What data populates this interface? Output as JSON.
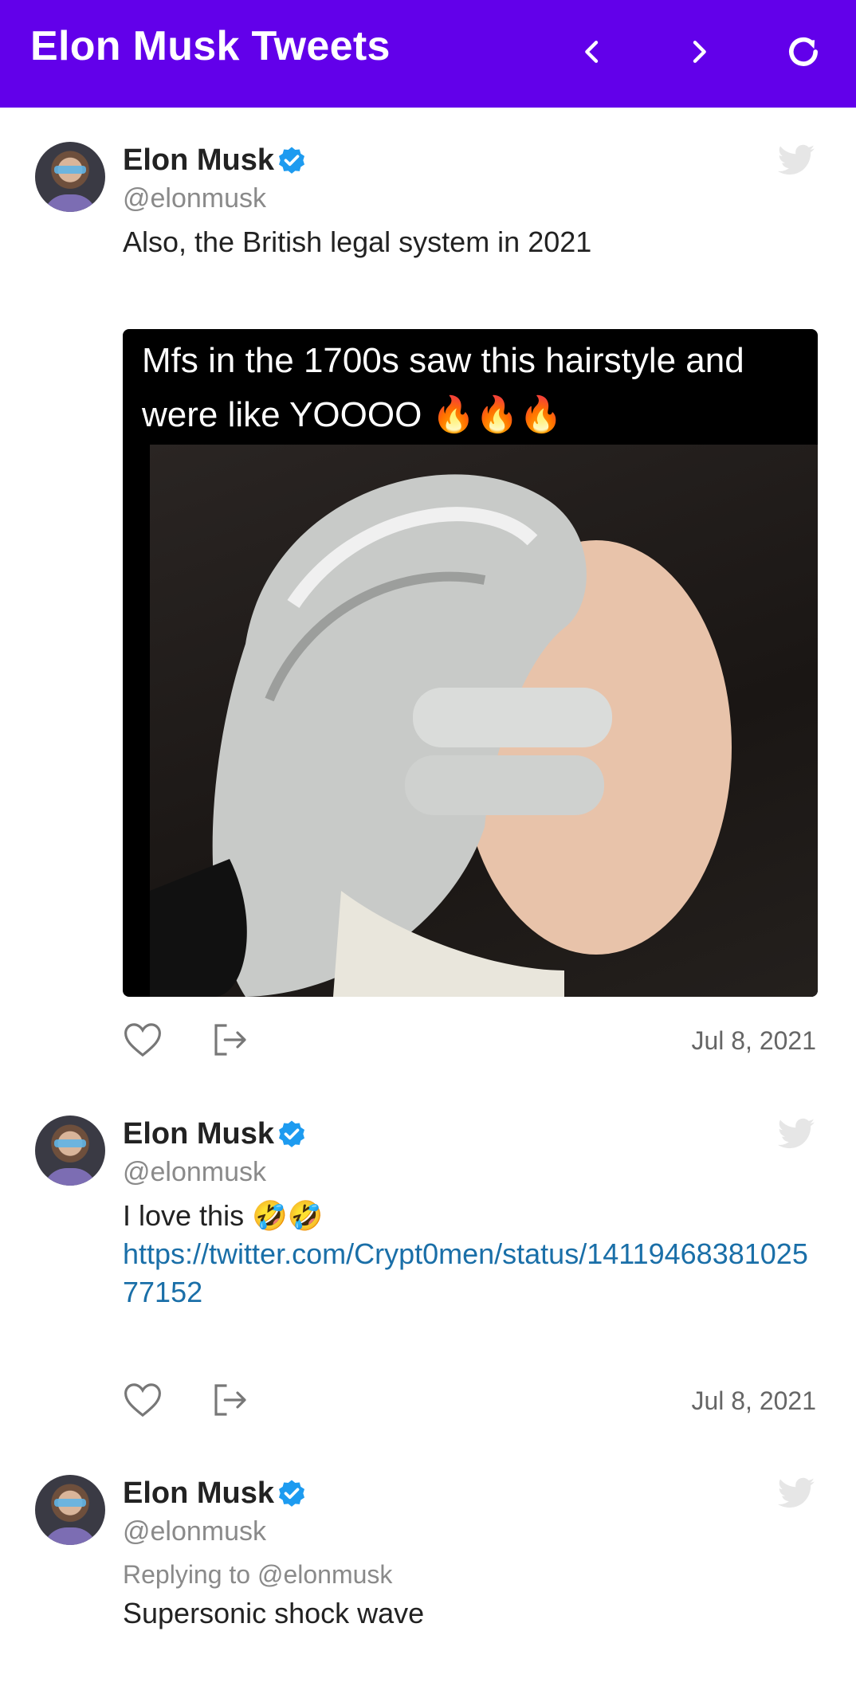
{
  "appbar": {
    "title": "Elon Musk Tweets",
    "icons": [
      "chevron-left-icon",
      "chevron-right-icon",
      "refresh-icon"
    ],
    "color": "#6200ea"
  },
  "tweets": [
    {
      "name": "Elon Musk",
      "handle": "@elonmusk",
      "text": "Also, the British legal system in 2021",
      "media_caption": "Mfs in the 1700s saw this hairstyle and were like YOOOO 🔥🔥🔥",
      "date": "Jul 8, 2021"
    },
    {
      "name": "Elon Musk",
      "handle": "@elonmusk",
      "text": "I love this 🤣🤣",
      "link": "https://twitter.com/Crypt0men/status/1411946838102577152",
      "date": "Jul 8, 2021"
    },
    {
      "name": "Elon Musk",
      "handle": "@elonmusk",
      "reply_to": "Replying to @elonmusk",
      "text": "Supersonic shock wave"
    }
  ],
  "colors": {
    "verified": "#1d9bf0",
    "link": "#1a6fa8",
    "bird": "#e6e6e6"
  }
}
